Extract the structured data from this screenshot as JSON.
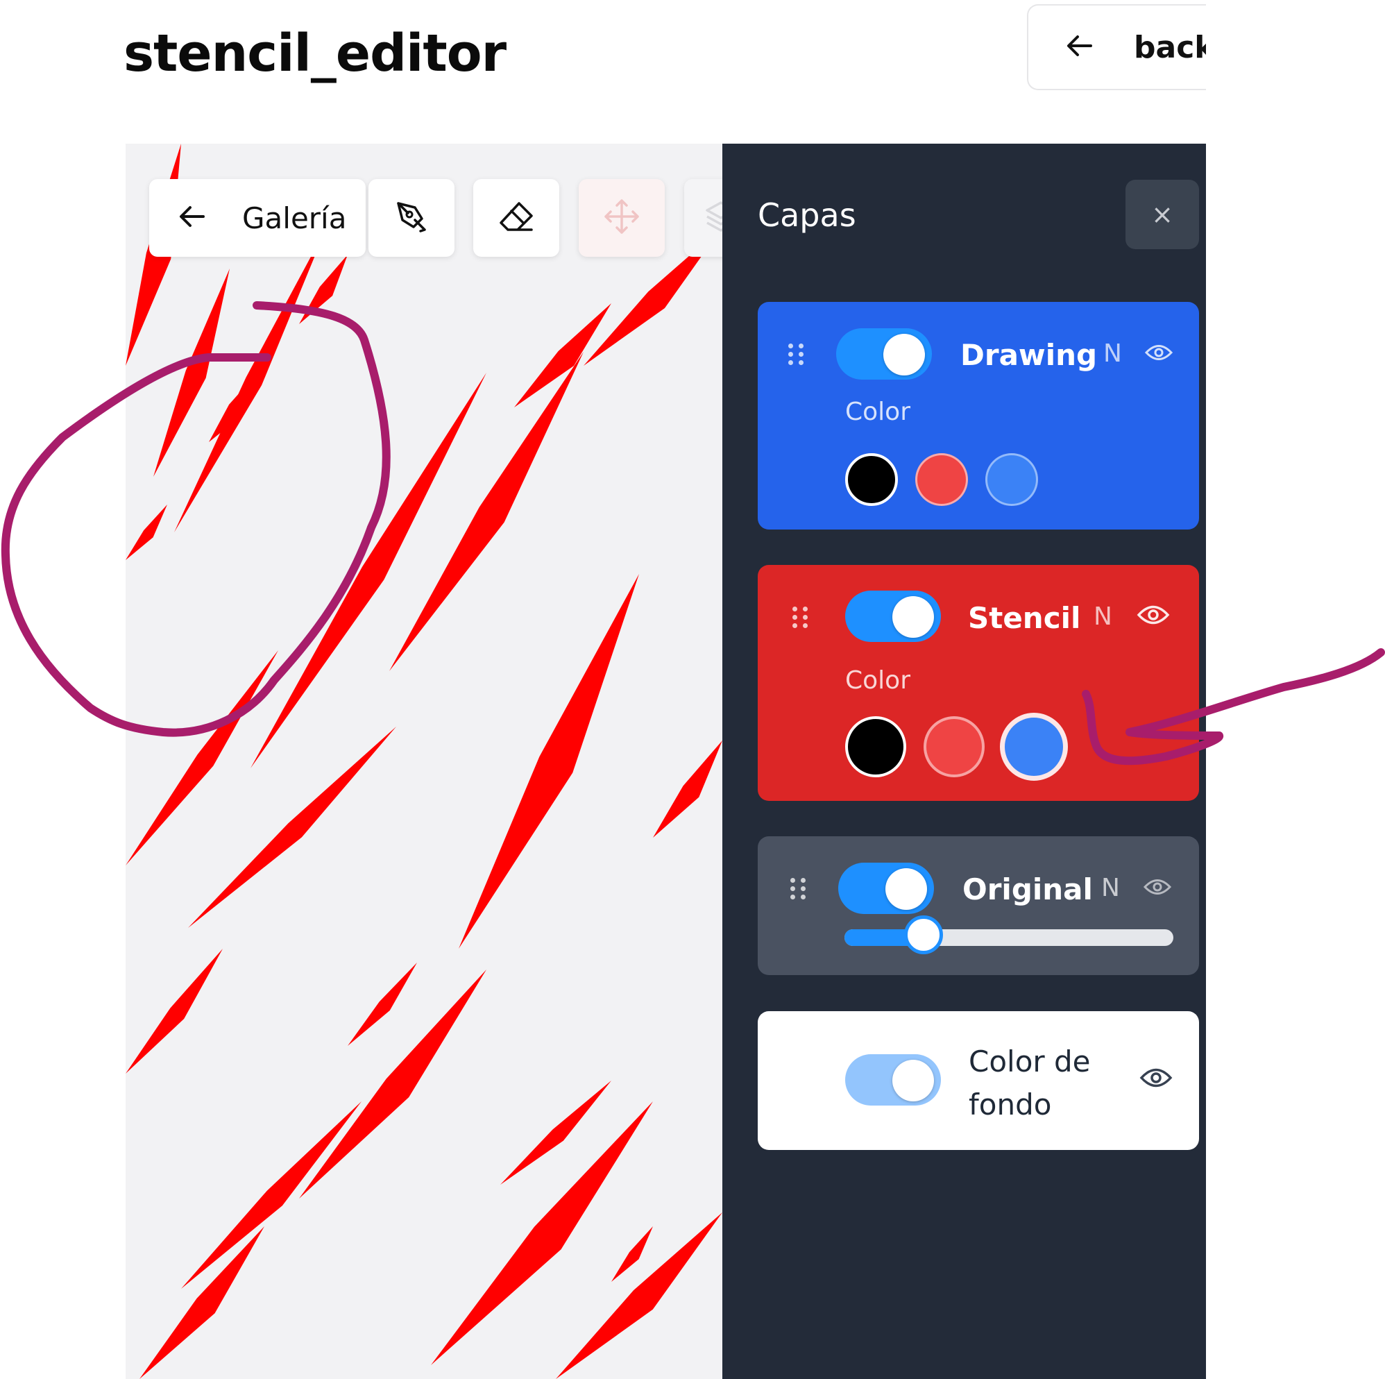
{
  "app": {
    "title": "stencil_editor",
    "back_label": "back"
  },
  "toolbar": {
    "galeria_label": "Galería",
    "tools": [
      "pen-tool-icon",
      "eraser-icon",
      "move-icon",
      "layers-icon"
    ]
  },
  "layers_panel": {
    "title": "Capas",
    "close_label": "×",
    "layers": [
      {
        "name": "Drawing",
        "blend": "N",
        "enabled": true,
        "visible": true,
        "color_label": "Color",
        "colors": [
          "#000000",
          "#ef4444",
          "#3b82f6"
        ],
        "selected_color": ""
      },
      {
        "name": "Stencil",
        "blend": "N",
        "enabled": true,
        "visible": true,
        "color_label": "Color",
        "colors": [
          "#000000",
          "#ef4444",
          "#3b82f6"
        ],
        "selected_color": "#3b82f6"
      },
      {
        "name": "Original",
        "blend": "N",
        "enabled": true,
        "visible": true,
        "opacity": 0.24
      },
      {
        "name": "Color de fondo",
        "enabled": true,
        "visible": true
      }
    ]
  },
  "colors": {
    "drawing_card": "#2563eb",
    "stencil_card": "#dc2626",
    "original_card": "#4a5261",
    "panel_bg": "#232b39",
    "toggle_on": "#1e90ff",
    "stencil_stroke": "#ff0000",
    "annotation_ink": "#a81d6b"
  }
}
